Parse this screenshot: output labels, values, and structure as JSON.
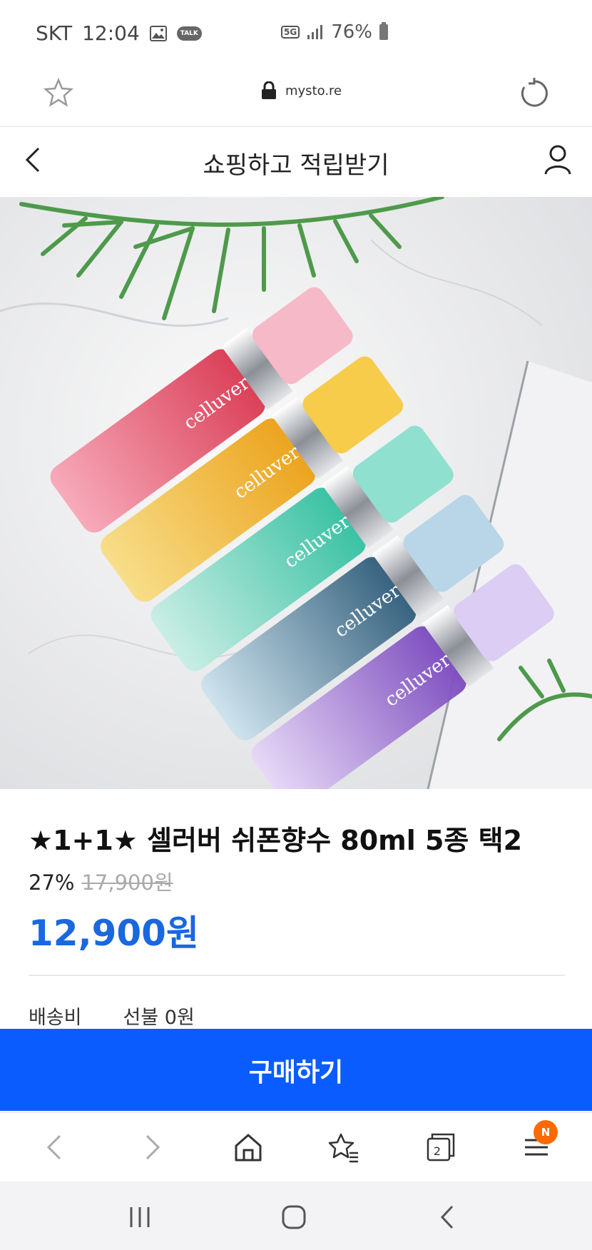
{
  "status_bar": {
    "carrier": "SKT",
    "time": "12:04",
    "talk_label": "TALK",
    "network": "5G",
    "battery": "76%"
  },
  "browser": {
    "url": "mysto.re"
  },
  "header": {
    "title": "쇼핑하고 적립받기"
  },
  "product": {
    "title": "★1+1★ 셀러버 쉬폰향수 80ml 5종 택2",
    "discount": "27%",
    "original_price": "17,900원",
    "sale_price": "12,900원",
    "shipping_label": "배송비",
    "shipping_value": "선불 0원",
    "brand_on_bottle": "celluver"
  },
  "buy_button": {
    "label": "구매하기"
  },
  "bottom_nav": {
    "tab_count": "2",
    "notification_badge": "N"
  },
  "colors": {
    "accent": "#0a5cff",
    "price": "#1a67e0",
    "badge": "#ff6a00"
  }
}
